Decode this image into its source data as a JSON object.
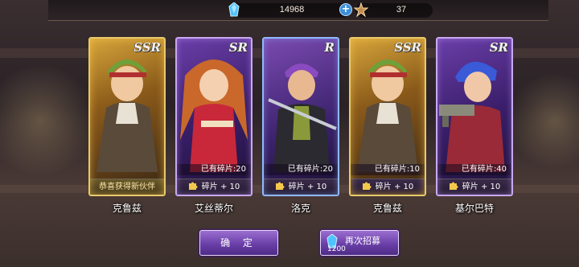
{
  "resources": {
    "crystal_icon": "blue-crystal-icon",
    "crystal_value": "14968",
    "add_icon": "plus-icon",
    "star_icon": "star-icon",
    "star_value": "37"
  },
  "cards": [
    {
      "rarity": "SSR",
      "shards_text": "",
      "status_text": "恭喜获得新伙伴",
      "name": "克鲁兹"
    },
    {
      "rarity": "SR",
      "shards_text": "已有碎片:20",
      "status_text": "碎片 + 10",
      "name": "艾丝蒂尔"
    },
    {
      "rarity": "R",
      "shards_text": "已有碎片:20",
      "status_text": "碎片 + 10",
      "name": "洛克"
    },
    {
      "rarity": "SSR",
      "shards_text": "已有碎片:10",
      "status_text": "碎片 + 10",
      "name": "克鲁兹"
    },
    {
      "rarity": "SR",
      "shards_text": "已有碎片:40",
      "status_text": "碎片 + 10",
      "name": "基尔巴特"
    }
  ],
  "buttons": {
    "confirm_label": "确 定",
    "recruit_label": "再次招募",
    "recruit_cost": "1200"
  },
  "colors": {
    "ssr_border": "#e8c96a",
    "sr_border": "#c8a8f0",
    "r_border": "#90b8ff",
    "button_purple": "#6a3fa8"
  }
}
